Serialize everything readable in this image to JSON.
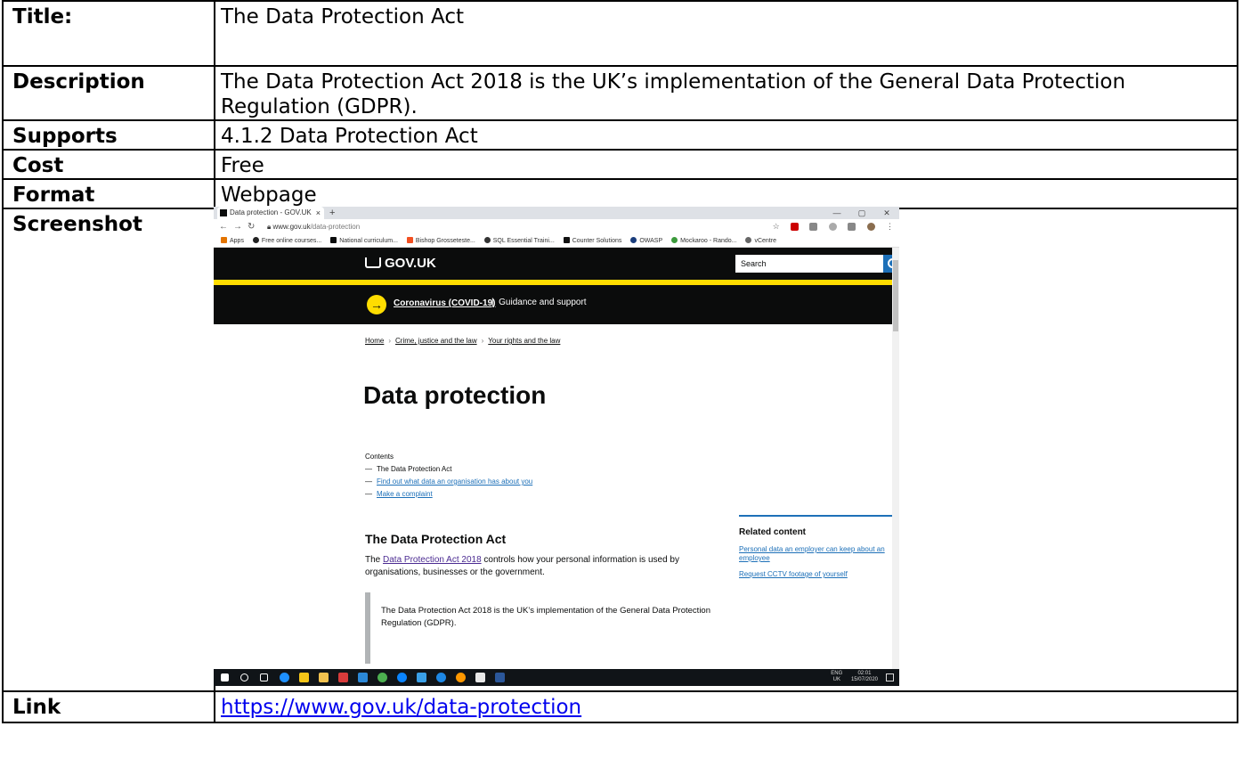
{
  "rows": {
    "title": {
      "label": "Title:",
      "value": "The Data Protection Act"
    },
    "description": {
      "label": "Description",
      "value": "The Data Protection Act 2018 is the UK’s implementation of the General Data Protection Regulation (GDPR)."
    },
    "supports": {
      "label": "Supports",
      "value": "4.1.2 Data Protection Act"
    },
    "cost": {
      "label": "Cost",
      "value": "Free"
    },
    "format": {
      "label": "Format",
      "value": "Webpage"
    },
    "screenshot": {
      "label": "Screenshot"
    },
    "link": {
      "label": "Link",
      "value": "https://www.gov.uk/data-protection"
    }
  },
  "browser": {
    "tab_title": "Data protection - GOV.UK",
    "tab_close": "×",
    "new_tab": "+",
    "url_host": "www.gov.uk",
    "url_path": "/data-protection",
    "bookmarks": [
      "Apps",
      "Free online courses...",
      "National curriculum...",
      "Bishop Grosseteste...",
      "SQL Essential Traini...",
      "Counter Solutions",
      "OWASP",
      "Mockaroo - Rando...",
      "vCentre"
    ]
  },
  "govuk": {
    "logo": "GOV.UK",
    "search_placeholder": "Search",
    "covid_link": "Coronavirus (COVID-19)",
    "covid_text": "Guidance and support",
    "breadcrumbs": [
      "Home",
      "Crime, justice and the law",
      "Your rights and the law"
    ],
    "title": "Data protection",
    "contents_heading": "Contents",
    "contents": [
      "The Data Protection Act",
      "Find out what data an organisation has about you",
      "Make a complaint"
    ],
    "section_title": "The Data Protection Act",
    "para_pre": "The ",
    "para_link": "Data Protection Act 2018",
    "para_post": " controls how your personal information is used by organisations, businesses or the government.",
    "inset": "The Data Protection Act 2018 is the UK’s implementation of the General Data Protection Regulation (GDPR).",
    "related_heading": "Related content",
    "related_links": [
      "Personal data an employer can keep about an employee",
      "Request CCTV footage of yourself"
    ]
  },
  "taskbar": {
    "lang": "ENG",
    "region": "UK",
    "time": "02:01",
    "date": "15/07/2020"
  },
  "colors": {
    "govuk_black": "#0b0c0c",
    "govuk_yellow": "#ffdd00",
    "govuk_link": "#1d70b8",
    "govuk_visited": "#4c2c92"
  }
}
